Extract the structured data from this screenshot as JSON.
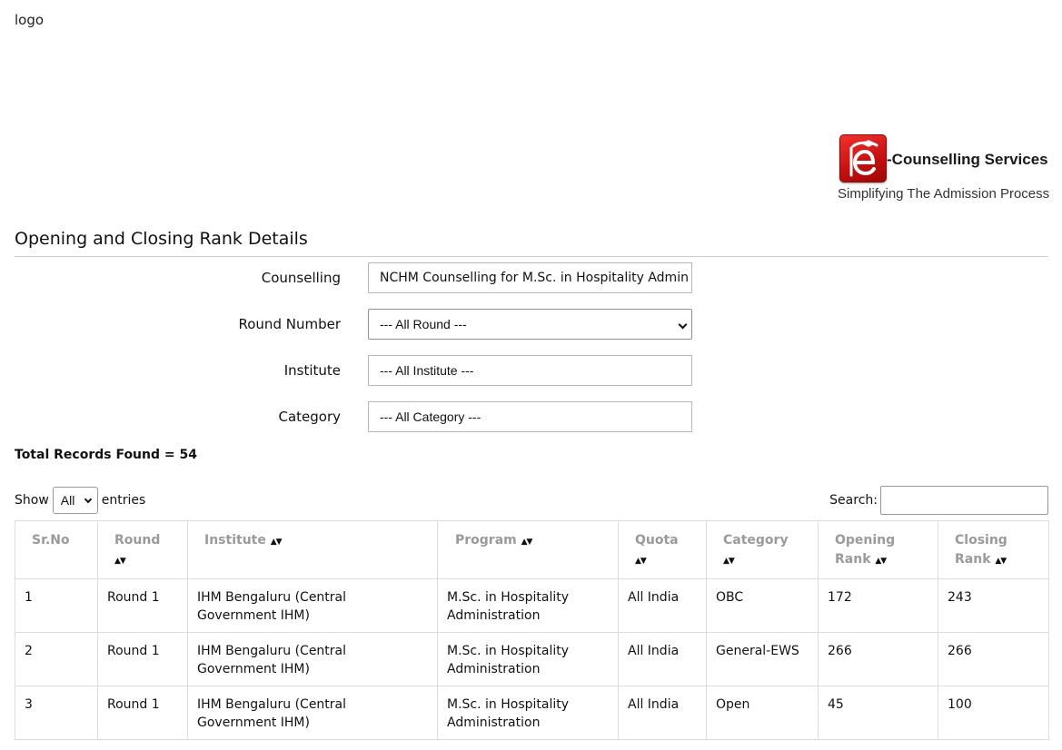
{
  "header": {
    "logo_alt": "logo",
    "brand": {
      "name": "-Counselling Services",
      "tagline": "Simplifying The Admission Process",
      "icon": "e-logo-icon",
      "accent": "#d81a1a"
    }
  },
  "page": {
    "title": "Opening and Closing Rank Details"
  },
  "filters": {
    "counselling": {
      "label": "Counselling",
      "value": "NCHM Counselling for M.Sc. in Hospitality Admin"
    },
    "round": {
      "label": "Round Number",
      "value": "--- All Round ---"
    },
    "institute": {
      "label": "Institute",
      "value": "--- All Institute ---"
    },
    "category": {
      "label": "Category",
      "value": "--- All Category ---"
    }
  },
  "summary": {
    "total_text": "Total Records Found = 54"
  },
  "table_controls": {
    "show_label": "Show",
    "length_value": "All",
    "entries_label": "entries",
    "search_label": "Search:",
    "search_value": ""
  },
  "table": {
    "sort_glyph": "▲▼",
    "headers": [
      "Sr.No",
      "Round",
      "Institute",
      "Program",
      "Quota",
      "Category",
      "Opening Rank",
      "Closing Rank"
    ],
    "rows": [
      {
        "sr": "1",
        "round": "Round 1",
        "institute": "IHM Bengaluru (Central Government IHM)",
        "program": "M.Sc. in Hospitality Administration",
        "quota": "All India",
        "category": "OBC",
        "opening": "172",
        "closing": "243"
      },
      {
        "sr": "2",
        "round": "Round 1",
        "institute": "IHM Bengaluru (Central Government IHM)",
        "program": "M.Sc. in Hospitality Administration",
        "quota": "All India",
        "category": "General-EWS",
        "opening": "266",
        "closing": "266"
      },
      {
        "sr": "3",
        "round": "Round 1",
        "institute": "IHM Bengaluru (Central Government IHM)",
        "program": "M.Sc. in Hospitality Administration",
        "quota": "All India",
        "category": "Open",
        "opening": "45",
        "closing": "100"
      }
    ]
  }
}
